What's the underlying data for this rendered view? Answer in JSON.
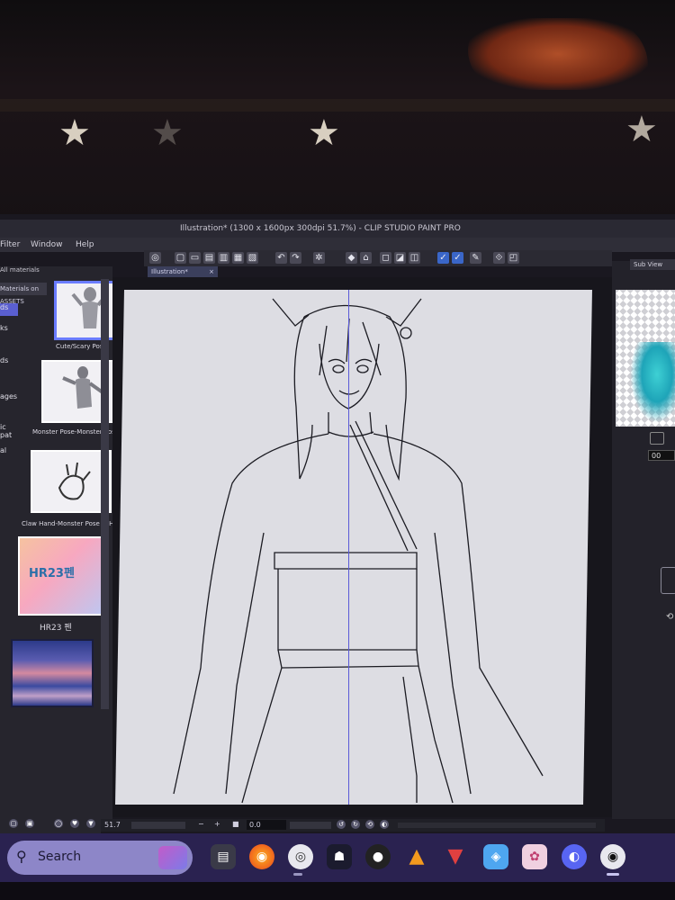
{
  "window": {
    "title": "Illustration* (1300 x 1600px 300dpi 51.7%) - CLIP STUDIO PAINT PRO"
  },
  "menu": {
    "items": [
      "Filter",
      "Window",
      "Help"
    ]
  },
  "materials_panel": {
    "header": "All materials",
    "assets_label": "Materials on ASSETS",
    "categories": [
      "ds",
      "ks",
      "ds",
      "ages",
      "ic pat",
      "al"
    ],
    "items": [
      {
        "label": "Cute/Scary Pose",
        "selected": true
      },
      {
        "label": "Monster Pose-Monster Pose + H",
        "selected": false
      },
      {
        "label": "Claw Hand-Monster Pose + Hand",
        "selected": false
      },
      {
        "label": "HR23 펜",
        "selected": false,
        "thumb_text": "HR23펜"
      }
    ]
  },
  "canvas": {
    "tab_label": "Illustration*",
    "tab_close": "×"
  },
  "sub_view": {
    "tab_label": "Sub View",
    "value": "00"
  },
  "status_bar": {
    "zoom": "51.7",
    "minus": "−",
    "plus": "+",
    "angle": "0.0"
  },
  "taskbar": {
    "search_placeholder": "Search",
    "apps": [
      "files-app",
      "firefox",
      "clip-studio-companion",
      "character-app",
      "obs",
      "vlc",
      "vivaldi",
      "paint-app",
      "anime-app",
      "discord",
      "clip-studio-paint"
    ]
  }
}
